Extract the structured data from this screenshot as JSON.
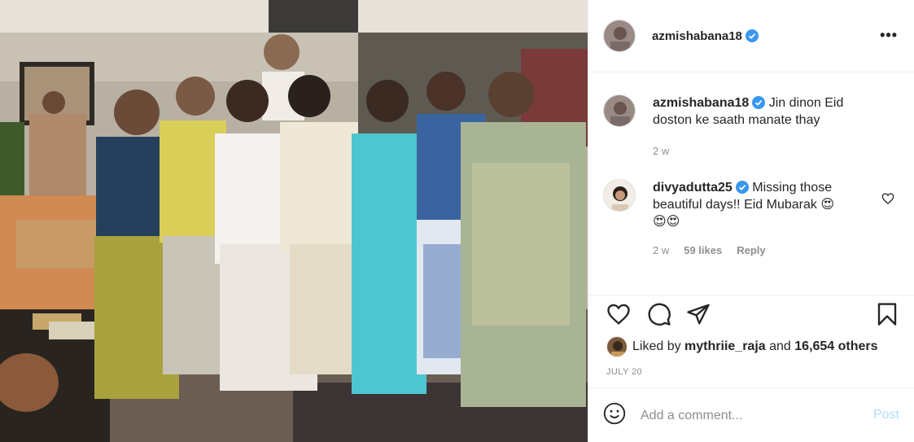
{
  "post": {
    "author": "azmishabana18",
    "caption": "Jin dinon Eid doston ke saath manate thay",
    "caption_time": "2 w",
    "more_label": "•••"
  },
  "comments": [
    {
      "user": "divyadutta25",
      "text": "Missing those beautiful days!! Eid Mubarak 😍",
      "text2": "😍😍",
      "time": "2 w",
      "likes": "59 likes",
      "reply": "Reply"
    }
  ],
  "likes": {
    "prefix": "Liked by",
    "user": "mythriie_raja",
    "middle": "and",
    "others": "16,654 others"
  },
  "date": "JULY 20",
  "composer": {
    "placeholder": "Add a comment...",
    "post_label": "Post"
  },
  "icons": [
    "more-icon",
    "heart-icon",
    "comment-icon",
    "share-icon",
    "bookmark-icon",
    "emoji-icon",
    "verified-icon"
  ],
  "colors": {
    "verified": "#3897f0",
    "post_disabled": "#b2dffc",
    "muted": "#8e8e8e"
  }
}
